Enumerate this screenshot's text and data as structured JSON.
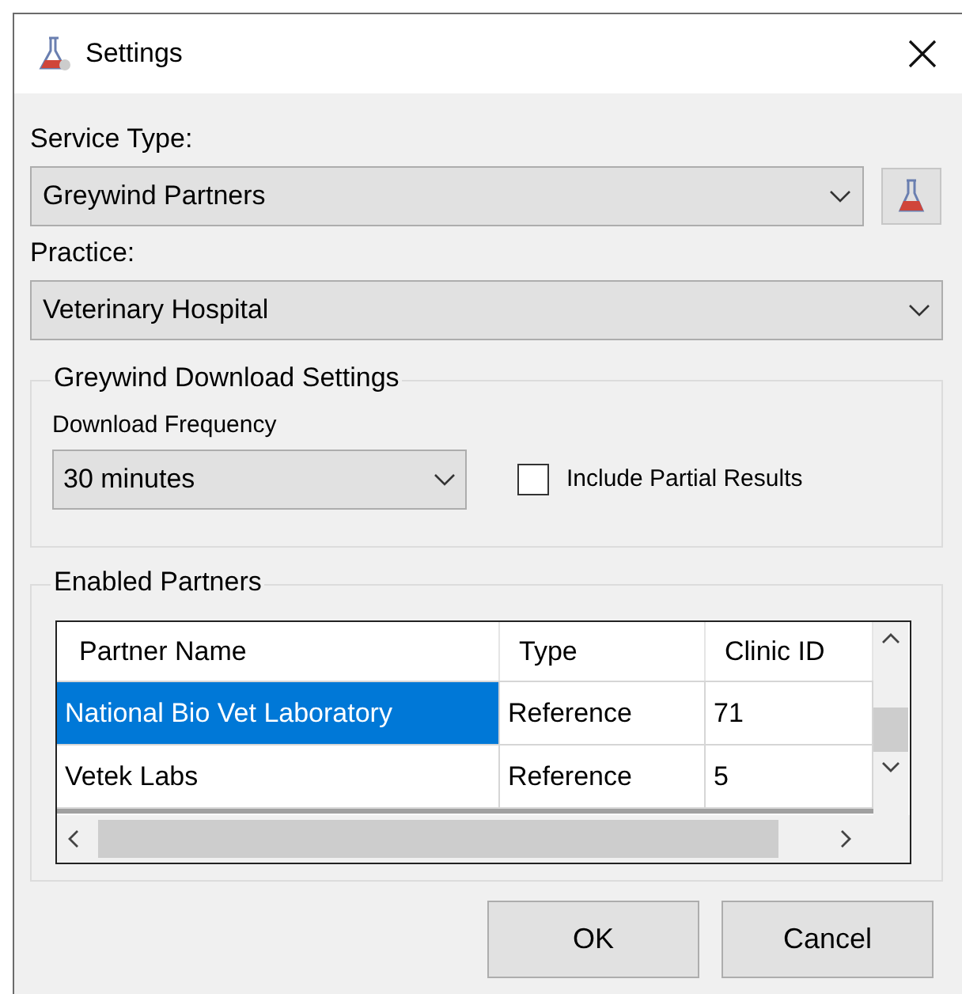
{
  "window": {
    "title": "Settings"
  },
  "service_type": {
    "label": "Service Type:",
    "value": "Greywind Partners"
  },
  "practice": {
    "label": "Practice:",
    "value": "Veterinary Hospital"
  },
  "download_settings": {
    "title": "Greywind Download Settings",
    "frequency_label": "Download Frequency",
    "frequency": "30 minutes",
    "include_partial": {
      "label": "Include Partial Results",
      "checked": false
    }
  },
  "enabled_partners": {
    "title": "Enabled Partners",
    "columns": [
      "Partner Name",
      "Type",
      "Clinic ID"
    ],
    "rows": [
      {
        "cells": [
          "National Bio Vet Laboratory",
          "Reference",
          "71"
        ],
        "selected": true
      },
      {
        "cells": [
          "Vetek Labs",
          "Reference",
          "5"
        ],
        "selected": false
      }
    ]
  },
  "buttons": [
    "OK",
    "Cancel"
  ]
}
